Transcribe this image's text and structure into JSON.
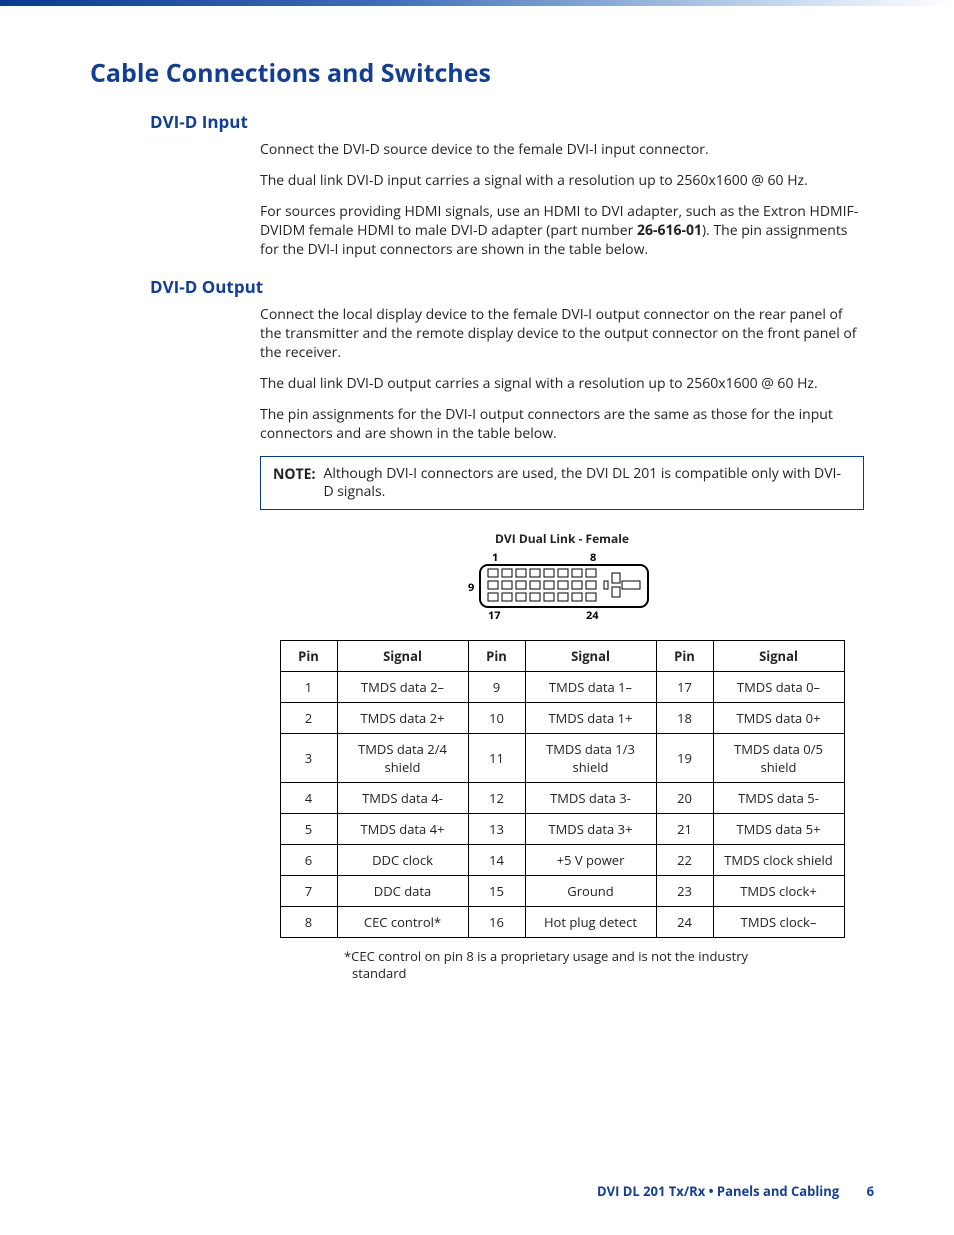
{
  "heading": "Cable Connections and Switches",
  "section_input": {
    "title": "DVI-D Input",
    "p1": "Connect the DVI-D source device to the female DVI-I input connector.",
    "p2": "The dual link DVI-D input carries a signal with a resolution up to 2560x1600 @ 60 Hz.",
    "p3_a": "For sources providing HDMI signals, use an HDMI to DVI adapter, such as the Extron HDMIF-DVIDM female HDMI to male DVI-D adapter (part number ",
    "p3_part": "26-616-01",
    "p3_b": "). The pin assignments for the DVI-I input connectors are shown in the table below."
  },
  "section_output": {
    "title": "DVI-D Output",
    "p1": "Connect the local display device to the female DVI-I output connector on the rear panel of the transmitter and the remote display device to the output connector on the front panel of the receiver.",
    "p2": "The dual link DVI-D output carries a signal with a resolution up to 2560x1600 @ 60 Hz.",
    "p3": "The pin assignments for the DVI-I output connectors are the same as those for the input connectors and are shown in the table below."
  },
  "note": {
    "label": "NOTE:",
    "text": "Although DVI-I connectors are used, the DVI DL 201 is compatible only with DVI-D signals."
  },
  "diagram": {
    "title": "DVI Dual Link - Female",
    "labels": {
      "tl": "1",
      "tr": "8",
      "ml": "9",
      "bl": "17",
      "br": "24"
    }
  },
  "table": {
    "headers": {
      "pin": "Pin",
      "signal": "Signal"
    },
    "rows": [
      {
        "p1": "1",
        "s1": "TMDS data 2–",
        "p2": "9",
        "s2": "TMDS data 1–",
        "p3": "17",
        "s3": "TMDS data 0–"
      },
      {
        "p1": "2",
        "s1": "TMDS data 2+",
        "p2": "10",
        "s2": "TMDS data 1+",
        "p3": "18",
        "s3": "TMDS data 0+"
      },
      {
        "p1": "3",
        "s1": "TMDS data 2/4 shield",
        "p2": "11",
        "s2": "TMDS data 1/3 shield",
        "p3": "19",
        "s3": "TMDS data 0/5 shield"
      },
      {
        "p1": "4",
        "s1": "TMDS data 4-",
        "p2": "12",
        "s2": "TMDS data 3-",
        "p3": "20",
        "s3": "TMDS data 5-"
      },
      {
        "p1": "5",
        "s1": "TMDS data 4+",
        "p2": "13",
        "s2": "TMDS data 3+",
        "p3": "21",
        "s3": "TMDS data 5+"
      },
      {
        "p1": "6",
        "s1": "DDC clock",
        "p2": "14",
        "s2": "+5 V power",
        "p3": "22",
        "s3": "TMDS clock shield"
      },
      {
        "p1": "7",
        "s1": "DDC data",
        "p2": "15",
        "s2": "Ground",
        "p3": "23",
        "s3": "TMDS clock+"
      },
      {
        "p1": "8",
        "s1": "CEC control*",
        "p2": "16",
        "s2": "Hot plug detect",
        "p3": "24",
        "s3": "TMDS clock–"
      }
    ]
  },
  "footnote": "*CEC control on pin 8 is a proprietary usage and is not the industry standard",
  "footer": {
    "doc": "DVI DL 201 Tx/Rx • Panels and Cabling",
    "page": "6"
  }
}
